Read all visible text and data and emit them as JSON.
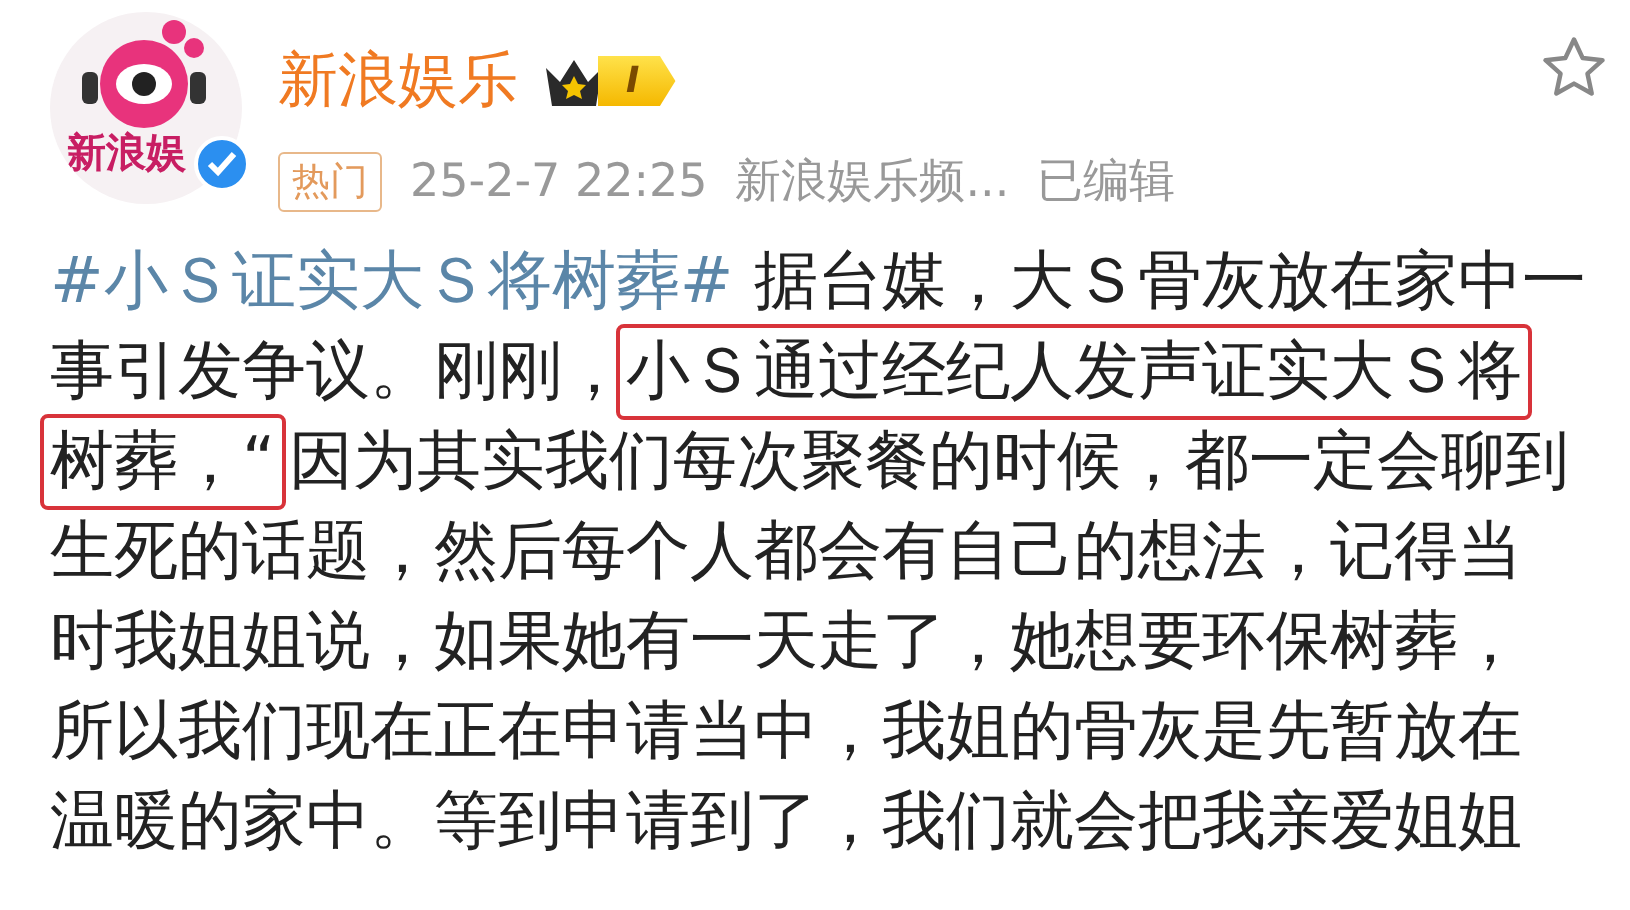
{
  "author": {
    "name": "新浪娱乐",
    "avatar_text": "新浪娱",
    "verified": true,
    "level_badge": "I"
  },
  "meta": {
    "tag": "热门",
    "time": "25-2-7 22:25",
    "source": "新浪娱乐频...",
    "edited": "已编辑"
  },
  "favorite": {
    "selected": false
  },
  "lines": [
    {
      "segments": [
        {
          "kind": "hashtag",
          "text": "#小Ｓ证实大Ｓ将树葬#"
        },
        {
          "kind": "text",
          "text": " 据台媒，大Ｓ骨灰放在家中一"
        }
      ]
    },
    {
      "segments": [
        {
          "kind": "text",
          "text": "事引发争议。刚刚，"
        },
        {
          "kind": "highlight",
          "text": "小Ｓ通过经纪人发声证实大Ｓ将"
        }
      ]
    },
    {
      "segments": [
        {
          "kind": "highlight",
          "text": "树葬，“"
        },
        {
          "kind": "text",
          "text": "因为其实我们每次聚餐的时候，都一定会聊到"
        }
      ]
    },
    {
      "segments": [
        {
          "kind": "text",
          "text": "生死的话题，然后每个人都会有自己的想法，记得当"
        }
      ]
    },
    {
      "segments": [
        {
          "kind": "text",
          "text": "时我姐姐说，如果她有一天走了，她想要环保树葬，"
        }
      ]
    },
    {
      "segments": [
        {
          "kind": "text",
          "text": "所以我们现在正在申请当中，我姐的骨灰是先暂放在"
        }
      ]
    },
    {
      "segments": [
        {
          "kind": "text",
          "text": "温暖的家中。等到申请到了，我们就会把我亲爱姐姐"
        }
      ]
    }
  ]
}
